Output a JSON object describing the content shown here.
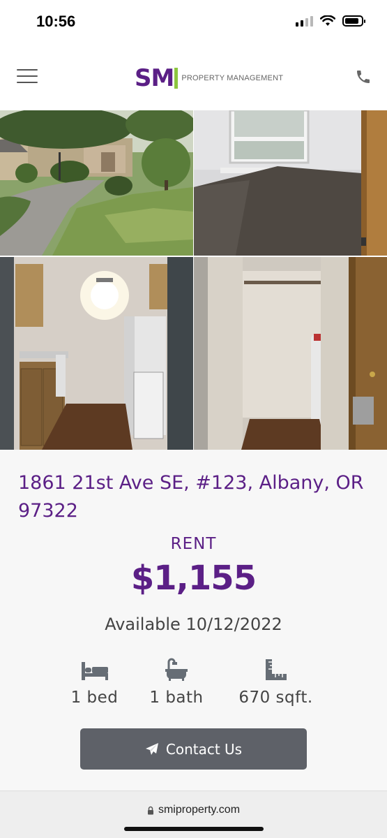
{
  "status_bar": {
    "time": "10:56",
    "icons": [
      "cellular-signal-icon",
      "wifi-icon",
      "battery-icon"
    ],
    "battery_level": 0.85
  },
  "header": {
    "logo_mark": "SM",
    "logo_text": "PROPERTY MANAGEMENT",
    "icons": [
      "hamburger-menu-icon",
      "phone-icon"
    ]
  },
  "photos": [
    {
      "name": "photo-exterior"
    },
    {
      "name": "photo-bedroom"
    },
    {
      "name": "photo-kitchen"
    },
    {
      "name": "photo-closet"
    }
  ],
  "listing": {
    "address": "1861 21st Ave SE, #123, Albany, OR 97322",
    "rent_label": "RENT",
    "rent_price": "$1,155",
    "available_label": "Available",
    "available_date": "10/12/2022",
    "beds": "1 bed",
    "baths": "1 bath",
    "sqft": "670 sqft.",
    "contact_label": "Contact Us"
  },
  "browser": {
    "url": "smiproperty.com"
  },
  "colors": {
    "brand_purple": "#5b1f86",
    "brand_green": "#8dc63f",
    "button_gray": "#5e6168"
  }
}
